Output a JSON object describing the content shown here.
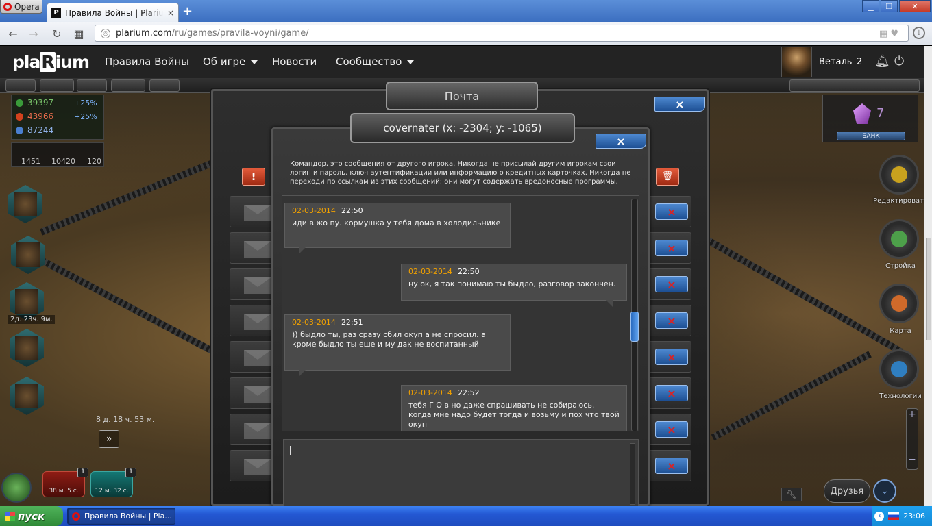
{
  "browser": {
    "menu_label": "Opera",
    "tab_title": "Правила Войны | Plarium",
    "tab_favicon": "P",
    "tab_close": "×",
    "new_tab": "+",
    "url_host": "plarium.com",
    "url_path": "/ru/games/pravila-voyni/game/",
    "nav_icons": [
      "back-icon",
      "forward-icon",
      "reload-icon",
      "speed-dial-icon"
    ]
  },
  "site": {
    "logo_pre": "pla",
    "logo_mid": "R",
    "logo_post": "ium",
    "menu": [
      "Правила Войны",
      "Об игре",
      "Новости",
      "Сообщество"
    ],
    "username": "Веталь_2_"
  },
  "game": {
    "resources": [
      {
        "value": "39397",
        "bonus": "+25%",
        "color": "#3a9a3a"
      },
      {
        "value": "43966",
        "bonus": "+25%",
        "color": "#d2421e"
      },
      {
        "value": "87244",
        "bonus": "",
        "color": "#4a7fd0"
      }
    ],
    "units": [
      "1451",
      "10420",
      "120"
    ],
    "timer_top": "2д. 23ч. 9м.",
    "timer_mid": "8 д. 18 ч. 53 м.",
    "queue": [
      {
        "time": "38 м. 5 с.",
        "count": "1"
      },
      {
        "time": "12 м. 32 с.",
        "count": "1"
      }
    ],
    "bank_value": "7",
    "bank_label": "БАНК",
    "right_buttons": [
      "Редактировать",
      "Стройка",
      "Карта",
      "Технологии"
    ],
    "friends_label": "Друзья"
  },
  "mail": {
    "title": "Почта",
    "close": "×",
    "alert": "!",
    "rows_delete": "×"
  },
  "chat": {
    "title": "covernater  (x: -2304; y: -1065)",
    "close": "×",
    "warning": "Командор, это сообщения от другого игрока. Никогда не присылай другим игрокам свои логин и пароль, ключ аутентификации или информацию о кредитных карточках. Никогда не переходи по ссылкам из этих сообщений: они могут содержать вредоносные программы.",
    "messages": [
      {
        "side": "left",
        "date": "02-03-2014",
        "time": "22:50",
        "text": "иди в жо пу. кормушка у тебя дома в холодильнике"
      },
      {
        "side": "right",
        "date": "02-03-2014",
        "time": "22:50",
        "text": "ну ок, я так понимаю ты быдло, разговор закончен."
      },
      {
        "side": "left",
        "date": "02-03-2014",
        "time": "22:51",
        "text": ")) быдло ты, раз сразу сбил окуп а не спросил. а кроме быдло ты еше и му дак не воспитанный"
      },
      {
        "side": "right",
        "date": "02-03-2014",
        "time": "22:52",
        "text": "тебя Г О в но даже спрашивать не собираюсь. когда мне надо будет тогда и возьму и пох что твой окуп"
      }
    ]
  },
  "taskbar": {
    "start": "пуск",
    "task": "Правила Войны | Pla...",
    "clock": "23:06"
  }
}
